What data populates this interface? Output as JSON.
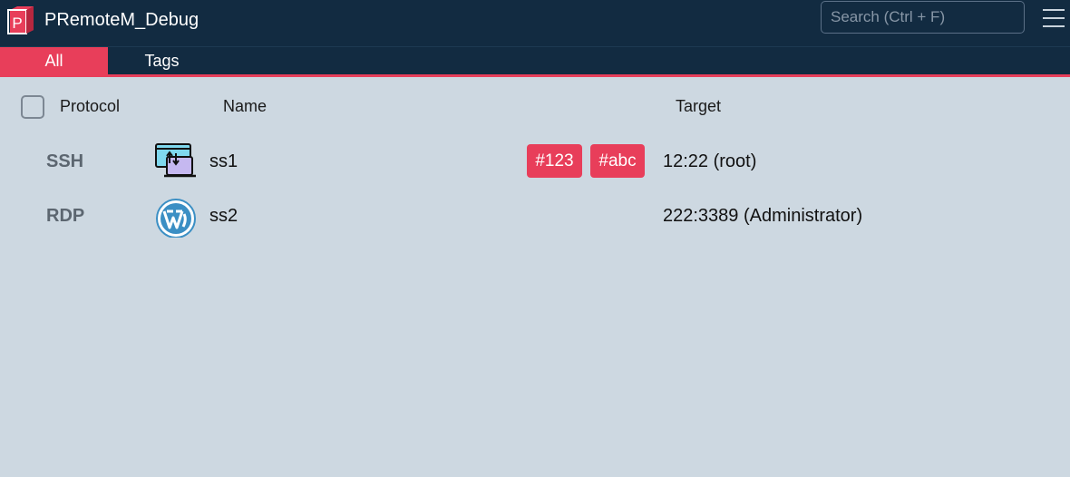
{
  "app": {
    "title": "PRemoteM_Debug",
    "logo_letter": "P",
    "accent_color": "#e83e5a",
    "titlebar_color": "#122b41"
  },
  "search": {
    "placeholder": "Search (Ctrl + F)",
    "value": ""
  },
  "tabs": [
    {
      "label": "All",
      "active": true
    },
    {
      "label": "Tags",
      "active": false
    }
  ],
  "table": {
    "headers": {
      "protocol": "Protocol",
      "name": "Name",
      "target": "Target"
    },
    "rows": [
      {
        "protocol": "SSH",
        "icon": "remote-transfer-icon",
        "name": "ss1",
        "tags": [
          "#123",
          "#abc"
        ],
        "target": "12:22 (root)"
      },
      {
        "protocol": "RDP",
        "icon": "wordpress-icon",
        "name": "ss2",
        "tags": [],
        "target": "222:3389 (Administrator)"
      }
    ]
  }
}
